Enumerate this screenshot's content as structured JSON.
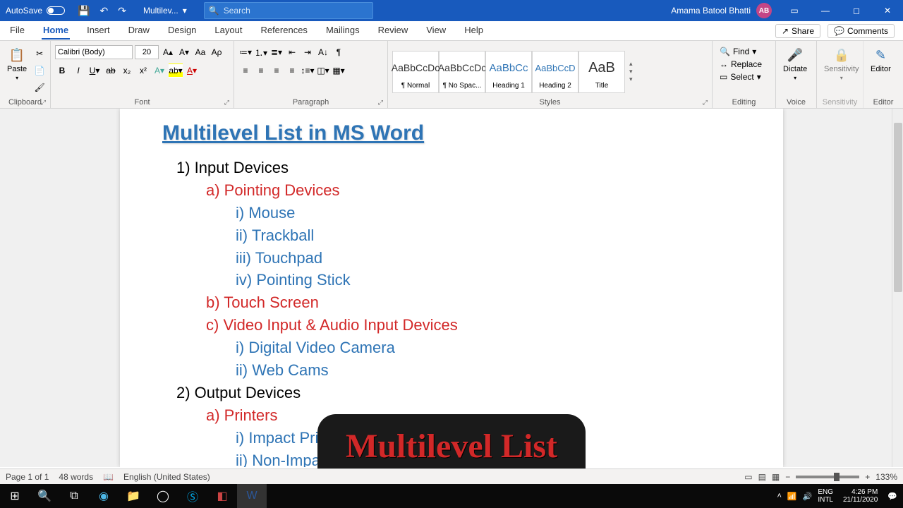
{
  "titlebar": {
    "autosave": "AutoSave",
    "doctitle": "Multilev...",
    "search_placeholder": "Search",
    "username": "Amama Batool Bhatti",
    "avatar_initials": "AB"
  },
  "tabs": {
    "items": [
      "File",
      "Home",
      "Insert",
      "Draw",
      "Design",
      "Layout",
      "References",
      "Mailings",
      "Review",
      "View",
      "Help"
    ],
    "active": 1,
    "share": "Share",
    "comments": "Comments"
  },
  "ribbon": {
    "clipboard": {
      "label": "Clipboard",
      "paste": "Paste"
    },
    "font": {
      "label": "Font",
      "name": "Calibri (Body)",
      "size": "20"
    },
    "paragraph": {
      "label": "Paragraph"
    },
    "styles": {
      "label": "Styles",
      "items": [
        {
          "preview": "AaBbCcDc",
          "name": "¶ Normal",
          "cls": ""
        },
        {
          "preview": "AaBbCcDc",
          "name": "¶ No Spac...",
          "cls": ""
        },
        {
          "preview": "AaBbCc",
          "name": "Heading 1",
          "cls": "h1"
        },
        {
          "preview": "AaBbCcD",
          "name": "Heading 2",
          "cls": "h2"
        },
        {
          "preview": "AaB",
          "name": "Title",
          "cls": "title"
        }
      ]
    },
    "editing": {
      "label": "Editing",
      "find": "Find",
      "replace": "Replace",
      "select": "Select"
    },
    "voice": {
      "label": "Voice",
      "dictate": "Dictate"
    },
    "sensitivity": {
      "label": "Sensitivity",
      "btn": "Sensitivity"
    },
    "editor": {
      "label": "Editor",
      "btn": "Editor"
    }
  },
  "document": {
    "title": "Multilevel List in MS Word",
    "lines": [
      {
        "lvl": 1,
        "t": "1)  Input Devices"
      },
      {
        "lvl": 2,
        "t": "a)  Pointing Devices"
      },
      {
        "lvl": 3,
        "t": "i)   Mouse"
      },
      {
        "lvl": 3,
        "t": "ii)  Trackball"
      },
      {
        "lvl": 3,
        "t": "iii) Touchpad"
      },
      {
        "lvl": 3,
        "t": "iv) Pointing Stick"
      },
      {
        "lvl": 2,
        "t": "b)  Touch Screen"
      },
      {
        "lvl": 2,
        "t": "c)  Video Input & Audio Input Devices"
      },
      {
        "lvl": 3,
        "t": "i)   Digital Video Camera"
      },
      {
        "lvl": 3,
        "t": "ii)  Web Cams"
      },
      {
        "lvl": 1,
        "t": "2)  Output Devices"
      },
      {
        "lvl": 2,
        "t": "a)  Printers"
      },
      {
        "lvl": 3,
        "t": "i)   Impact Printer"
      },
      {
        "lvl": 3,
        "t": "ii)  Non-Impact Printer"
      }
    ]
  },
  "statusbar": {
    "page": "Page 1 of 1",
    "words": "48 words",
    "lang": "English (United States)",
    "zoom": "133%"
  },
  "taskbar": {
    "lang": "ENG",
    "kb": "INTL",
    "time": "4:26 PM",
    "date": "21/11/2020"
  },
  "overlay": "Multilevel List"
}
